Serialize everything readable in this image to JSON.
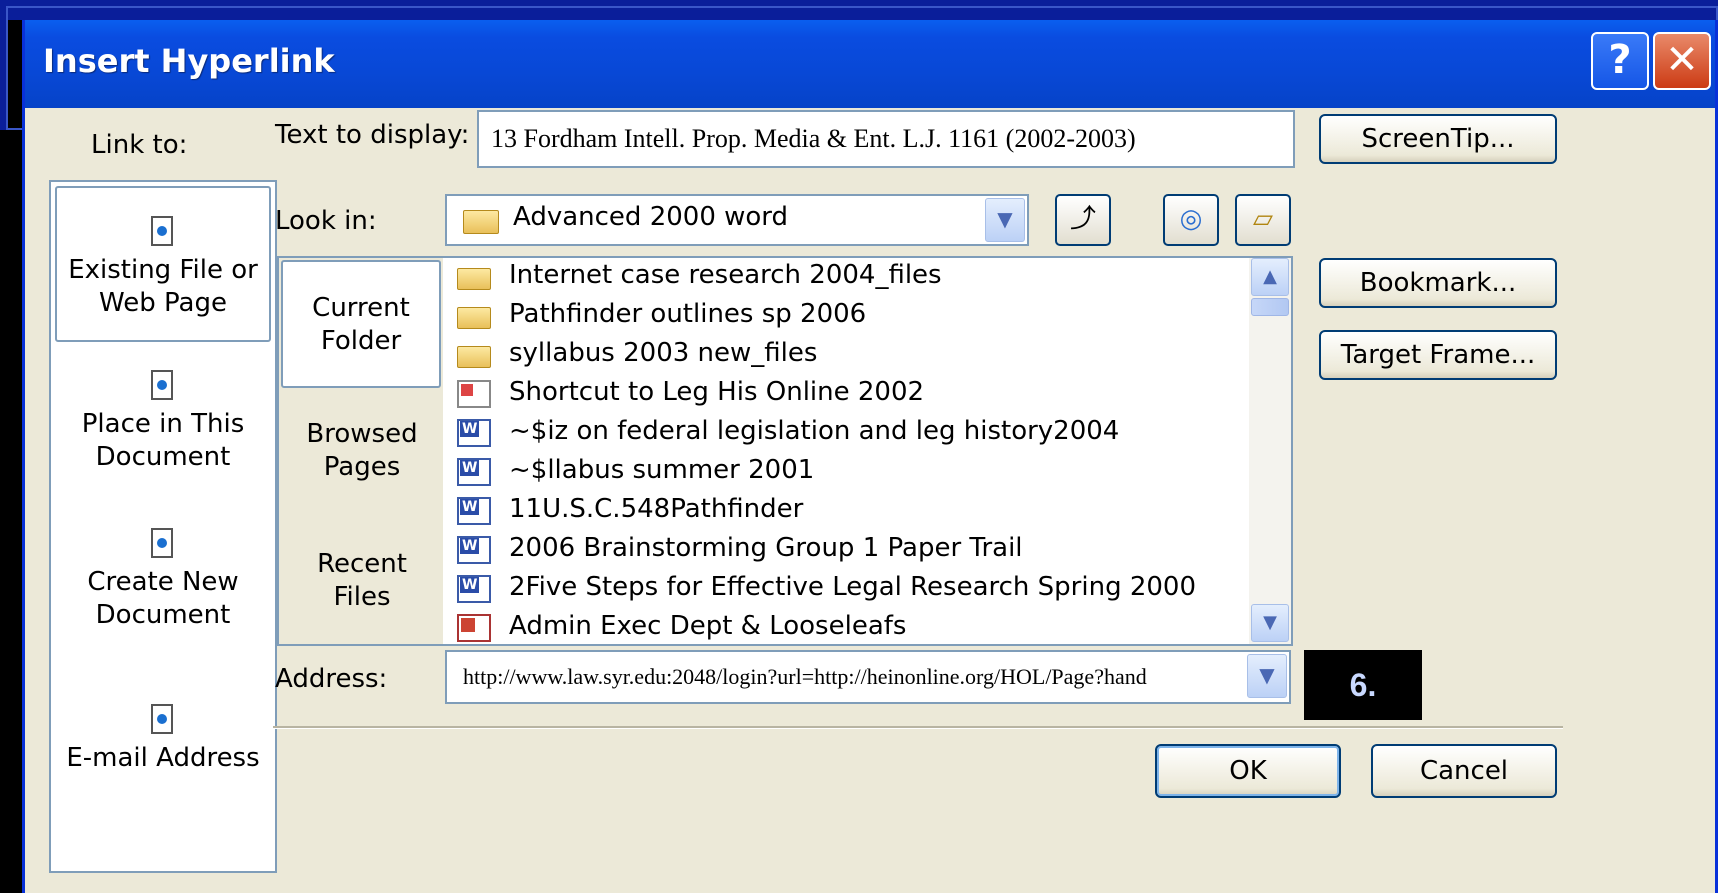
{
  "dialog": {
    "title": "Insert Hyperlink",
    "help_button": "?",
    "close_button": "✕",
    "link_to_label": "Link to:",
    "link_to_items": [
      {
        "label_line1": "Existing File or",
        "label_line2": "Web Page",
        "icon": "existing-file-icon",
        "selected": true
      },
      {
        "label_line1": "Place in This",
        "label_line2": "Document",
        "icon": "place-in-document-icon",
        "selected": false
      },
      {
        "label_line1": "Create New",
        "label_line2": "Document",
        "icon": "create-new-document-icon",
        "selected": false
      },
      {
        "label_line1": "E-mail Address",
        "label_line2": "",
        "icon": "email-address-icon",
        "selected": false
      }
    ],
    "text_to_display_label": "Text to display:",
    "text_to_display_value": "13 Fordham Intell. Prop. Media & Ent. L.J. 1161 (2002-2003)",
    "screentip_button": "ScreenTip...",
    "look_in_label": "Look in:",
    "look_in_value": "Advanced 2000 word",
    "nav_items": [
      {
        "line1": "Current",
        "line2": "Folder",
        "selected": true
      },
      {
        "line1": "Browsed",
        "line2": "Pages",
        "selected": false
      },
      {
        "line1": "Recent",
        "line2": "Files",
        "selected": false
      }
    ],
    "files": [
      {
        "name": "Internet case research 2004_files",
        "type": "folder"
      },
      {
        "name": "Pathfinder outlines sp 2006",
        "type": "folder"
      },
      {
        "name": "syllabus 2003 new_files",
        "type": "folder"
      },
      {
        "name": "Shortcut to Leg His Online 2002",
        "type": "shortcut"
      },
      {
        "name": "~$iz on federal legislation and leg history2004",
        "type": "word"
      },
      {
        "name": "~$llabus summer 2001",
        "type": "word"
      },
      {
        "name": "11U.S.C.548Pathfinder",
        "type": "word"
      },
      {
        "name": "2006  Brainstorming Group 1 Paper Trail",
        "type": "word"
      },
      {
        "name": "2Five Steps for Effective Legal Research Spring 2000",
        "type": "word"
      },
      {
        "name": "Admin Exec Dept & Looseleafs",
        "type": "access"
      }
    ],
    "bookmark_button": "Bookmark...",
    "target_frame_button": "Target Frame...",
    "address_label": "Address:",
    "address_value": "http://www.law.syr.edu:2048/login?url=http://heinonline.org/HOL/Page?hand",
    "ok_button": "OK",
    "cancel_button": "Cancel"
  },
  "step_label": "6.",
  "colors": {
    "titlebar": "#0a4ce0",
    "dialog_face": "#ece9d8",
    "field_border": "#7f9db9",
    "background": "#000000"
  }
}
